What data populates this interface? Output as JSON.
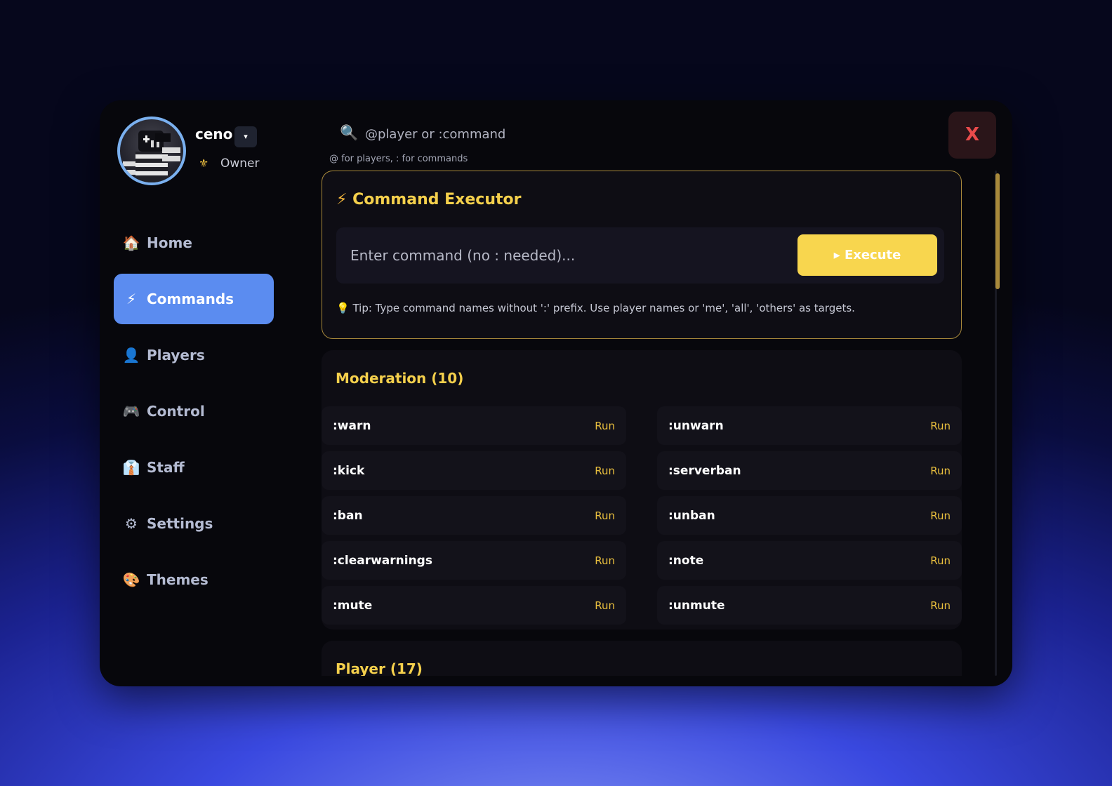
{
  "user": {
    "name": "ceno",
    "dropdown_glyph": "▾",
    "role": "Owner",
    "role_icon": "⚜"
  },
  "nav": [
    {
      "icon": "🏠",
      "label": "Home"
    },
    {
      "icon": "⚡",
      "label": "Commands"
    },
    {
      "icon": "👤",
      "label": "Players"
    },
    {
      "icon": "🎮",
      "label": "Control"
    },
    {
      "icon": "👔",
      "label": "Staff"
    },
    {
      "icon": "⚙",
      "label": "Settings"
    },
    {
      "icon": "🎨",
      "label": "Themes"
    }
  ],
  "search": {
    "icon": "🔍",
    "placeholder": "@player or :command",
    "hint": "@ for players, : for commands"
  },
  "close_label": "X",
  "executor": {
    "icon": "⚡",
    "title": "Command Executor",
    "placeholder": "Enter command (no : needed)...",
    "button": "▸ Execute",
    "tip": "💡 Tip: Type command names without ':' prefix. Use player names or 'me', 'all', 'others' as targets."
  },
  "categories": [
    {
      "title": "Moderation (10)",
      "commands": [
        ":warn",
        ":unwarn",
        ":kick",
        ":serverban",
        ":ban",
        ":unban",
        ":clearwarnings",
        ":note",
        ":mute",
        ":unmute"
      ],
      "run_label": "Run"
    },
    {
      "title": "Player (17)"
    }
  ],
  "colors": {
    "accent": "#f5d04c",
    "active_nav": "#5b8cf0",
    "close": "#e94b4b",
    "run": "#e9bf3e"
  }
}
